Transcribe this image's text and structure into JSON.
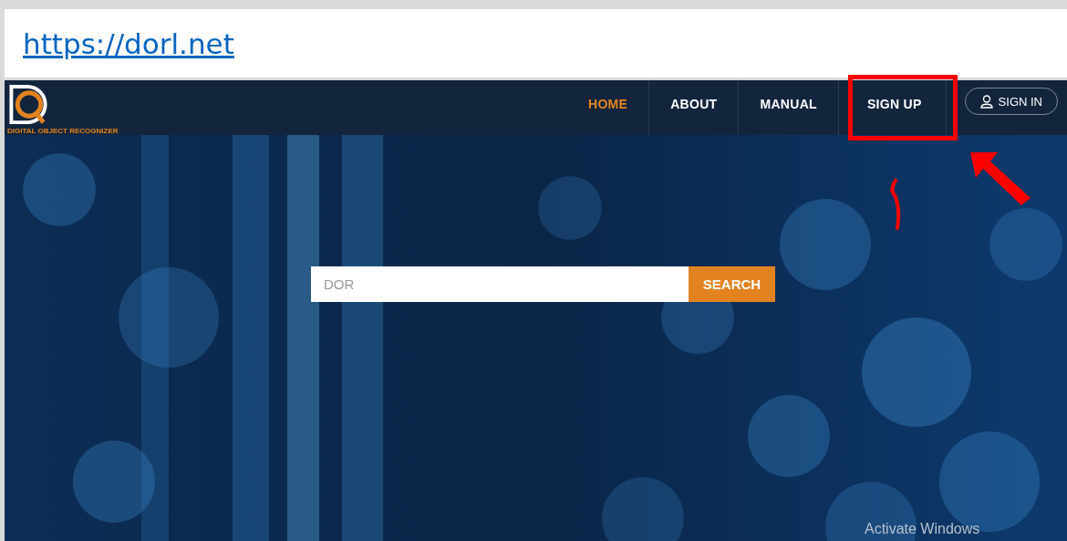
{
  "address_bar": {
    "url": "https://dorl.net"
  },
  "site": {
    "logo_text": "DIGITAL OBJECT RECOGNIZER",
    "nav": [
      {
        "label": "HOME",
        "selected": true
      },
      {
        "label": "ABOUT",
        "selected": false
      },
      {
        "label": "MANUAL",
        "selected": false
      },
      {
        "label": "SIGN UP",
        "selected": false
      }
    ],
    "sign_in": "SIGN IN",
    "search": {
      "placeholder": "DOR",
      "button": "SEARCH"
    }
  },
  "os_notice": "Activate Windows"
}
